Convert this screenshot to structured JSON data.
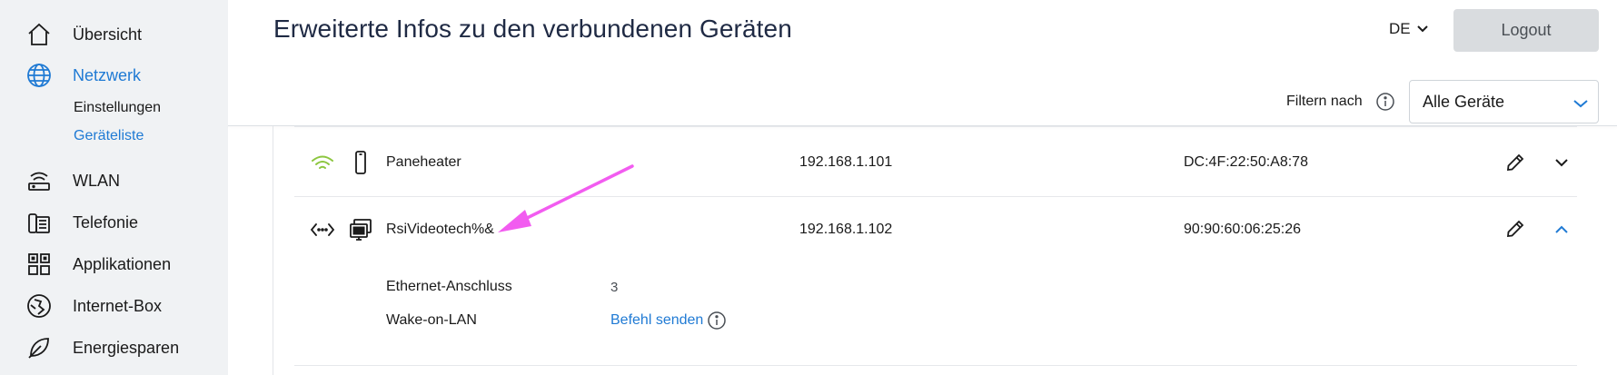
{
  "sidebar": {
    "items": [
      {
        "label": "Übersicht",
        "icon": "home-icon"
      },
      {
        "label": "Netzwerk",
        "icon": "globe-icon",
        "active": true,
        "subitems": [
          {
            "label": "Einstellungen"
          },
          {
            "label": "Geräteliste",
            "active": true
          }
        ]
      },
      {
        "label": "WLAN",
        "icon": "router-icon"
      },
      {
        "label": "Telefonie",
        "icon": "phone-icon"
      },
      {
        "label": "Applikationen",
        "icon": "apps-grid-icon"
      },
      {
        "label": "Internet-Box",
        "icon": "internet-box-icon"
      },
      {
        "label": "Energiesparen",
        "icon": "leaf-icon"
      }
    ]
  },
  "header": {
    "title": "Erweiterte Infos zu den verbundenen Geräten",
    "language": "DE",
    "logout_label": "Logout",
    "filter_label": "Filtern nach",
    "filter_value": "Alle Geräte"
  },
  "devices": [
    {
      "connection": "wifi",
      "connection_icon": "wifi-icon",
      "device_icon": "mobile-device-icon",
      "name": "Paneheater",
      "ip": "192.168.1.101",
      "mac": "DC:4F:22:50:A8:78",
      "expanded": false
    },
    {
      "connection": "ethernet",
      "connection_icon": "ethernet-icon",
      "device_icon": "computer-icon",
      "name": "RsiVideotech%&",
      "ip": "192.168.1.102",
      "mac": "90:90:60:06:25:26",
      "expanded": true,
      "details": {
        "ethernet_port_label": "Ethernet-Anschluss",
        "ethernet_port_value": "3",
        "wol_label": "Wake-on-LAN",
        "wol_action": "Befehl senden"
      }
    }
  ],
  "colors": {
    "accent": "#1f7ad4",
    "wifi_green": "#8cc63f",
    "annotation_arrow": "#f25cf0",
    "sidebar_bg": "#f0f2f4"
  }
}
